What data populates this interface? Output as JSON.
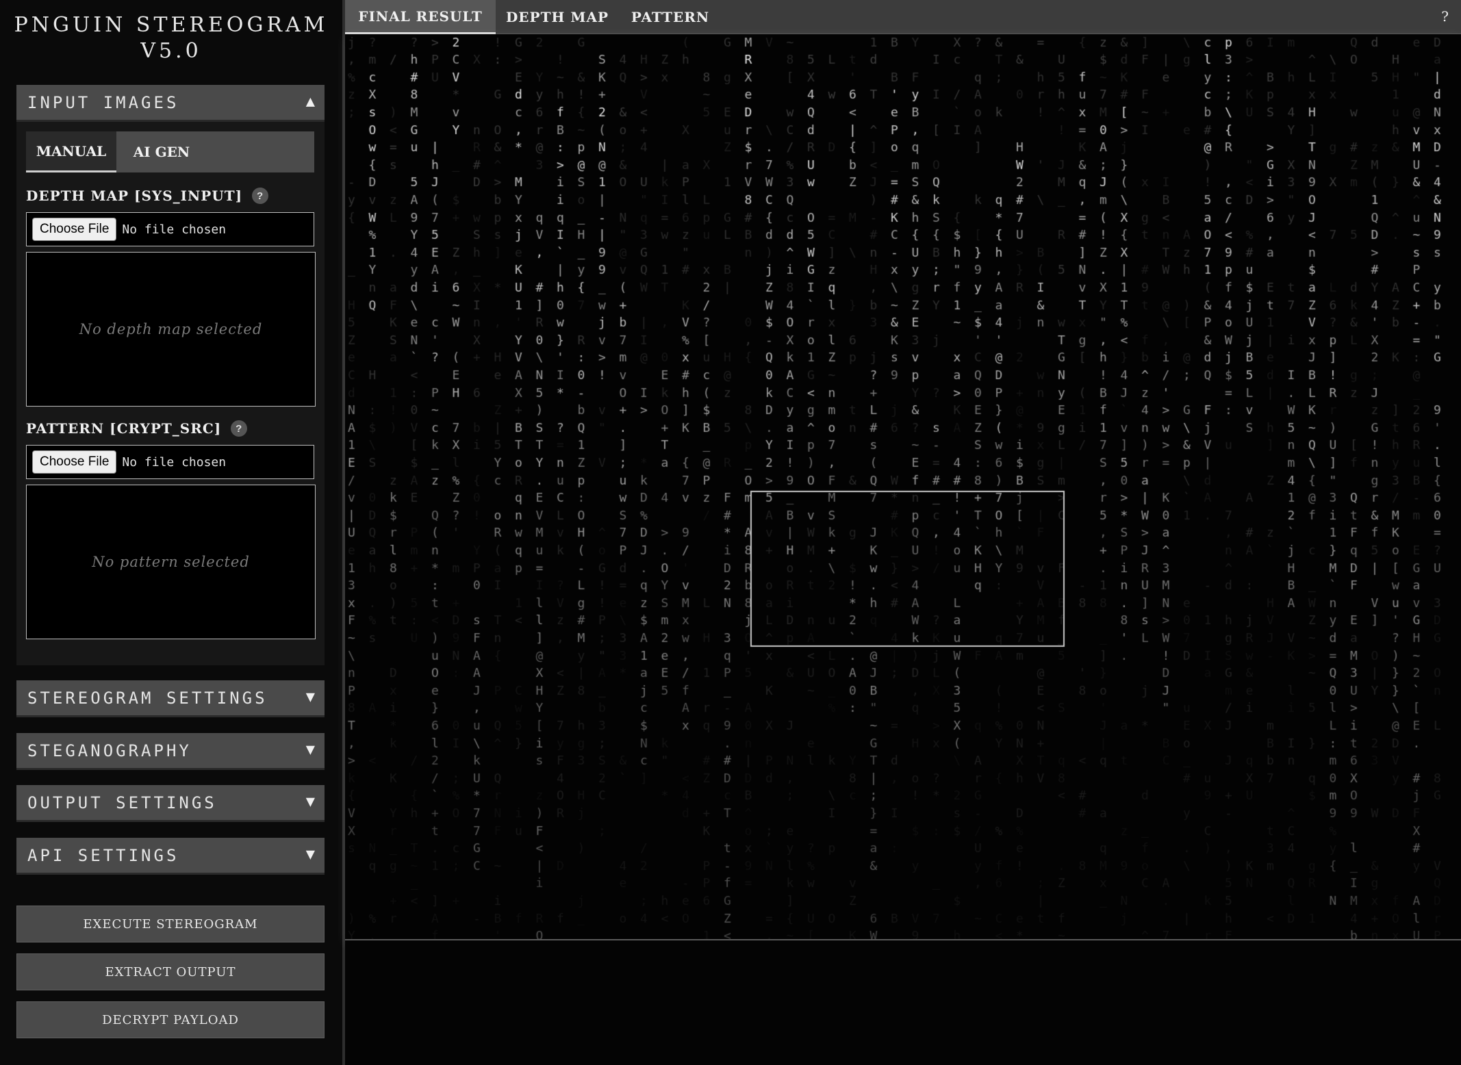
{
  "app": {
    "title_line1": "PNGUIN STEREOGRAM",
    "title_line2": "V5.0"
  },
  "sidebar": {
    "input_images": {
      "header": "INPUT IMAGES",
      "expanded_arrow": "▲",
      "tabs": [
        {
          "label": "MANUAL",
          "active": true
        },
        {
          "label": "AI GEN",
          "active": false
        }
      ],
      "depth_map": {
        "label": "DEPTH MAP [SYS_INPUT]",
        "help": "?",
        "button": "Choose File",
        "status": "No file chosen",
        "placeholder": "No depth map selected"
      },
      "pattern": {
        "label": "PATTERN [CRYPT_SRC]",
        "help": "?",
        "button": "Choose File",
        "status": "No file chosen",
        "placeholder": "No pattern selected"
      }
    },
    "collapsed_sections": [
      {
        "header": "STEREOGRAM SETTINGS",
        "arrow": "▼"
      },
      {
        "header": "STEGANOGRAPHY",
        "arrow": "▼"
      },
      {
        "header": "OUTPUT SETTINGS",
        "arrow": "▼"
      },
      {
        "header": "API SETTINGS",
        "arrow": "▼"
      }
    ],
    "actions": [
      {
        "label": "EXECUTE STEREOGRAM"
      },
      {
        "label": "EXTRACT OUTPUT"
      },
      {
        "label": "DECRYPT PAYLOAD"
      }
    ]
  },
  "main": {
    "tabs": [
      {
        "label": "FINAL RESULT",
        "active": true
      },
      {
        "label": "DEPTH MAP",
        "active": false
      },
      {
        "label": "PATTERN",
        "active": false
      }
    ],
    "help": "?"
  },
  "colors": {
    "background": "#000000",
    "panel": "#171717",
    "header": "#4a4a4a",
    "glyph_bright": "#e6e6e6",
    "glyph_dim": "#3a3a3a"
  }
}
